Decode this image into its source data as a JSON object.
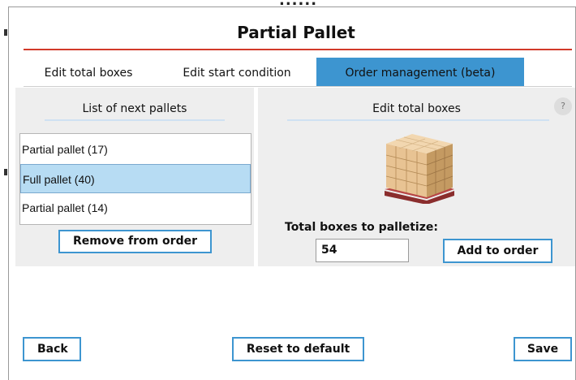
{
  "header": {
    "cut_text": "......",
    "title": "Partial Pallet"
  },
  "tabs": [
    {
      "label": "Edit total boxes",
      "active": false
    },
    {
      "label": "Edit start condition",
      "active": false
    },
    {
      "label": "Order management (beta)",
      "active": true
    }
  ],
  "left_panel": {
    "heading": "List of next pallets",
    "items": [
      {
        "label": "Partial pallet (17)",
        "selected": false
      },
      {
        "label": "Full pallet (40)",
        "selected": true
      },
      {
        "label": "Partial pallet (14)",
        "selected": false
      }
    ],
    "remove_button": "Remove from order"
  },
  "right_panel": {
    "heading": "Edit total boxes",
    "help_label": "?",
    "total_label": "Total boxes to palletize:",
    "total_value": "54",
    "add_button": "Add to order"
  },
  "footer": {
    "back": "Back",
    "reset": "Reset to default",
    "save": "Save"
  },
  "colors": {
    "accent": "#3d95d0",
    "title_rule": "#d23a2a",
    "selected_row": "#b7dcf3",
    "panel_bg": "#eeeeee"
  },
  "icons": {
    "pallet_image": "pallet-boxes-icon",
    "help": "help-icon"
  }
}
